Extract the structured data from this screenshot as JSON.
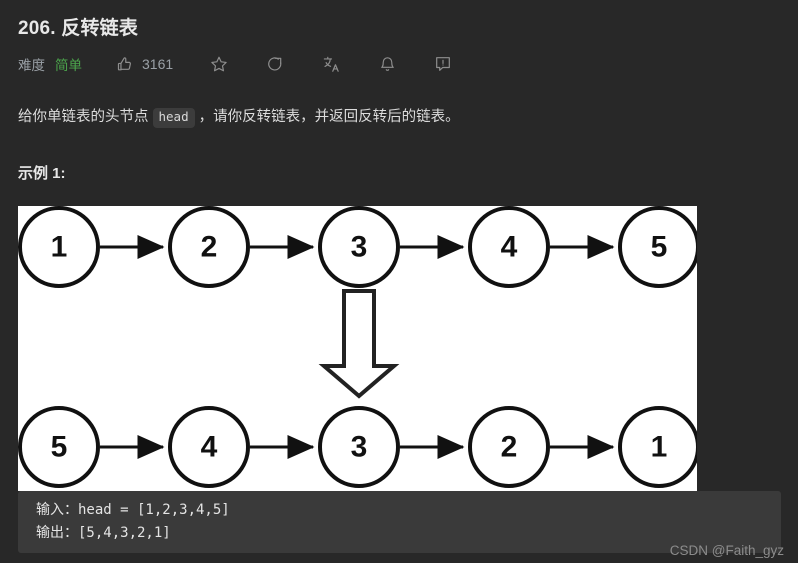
{
  "problem": {
    "title": "206. 反转链表",
    "difficulty_label": "难度",
    "difficulty_value": "简单",
    "likes_count": "3161",
    "description_part1": "给你单链表的头节点",
    "description_code": "head",
    "description_part2": "，请你反转链表，并返回反转后的链表。",
    "example_heading": "示例 1:"
  },
  "toolbar": {
    "thumbs_up_icon": "thumbs-up-icon",
    "star_icon": "star-icon",
    "share_icon": "share-icon",
    "translate_icon": "translate-icon",
    "bell_icon": "bell-icon",
    "feedback_icon": "feedback-icon"
  },
  "diagram": {
    "top_row": [
      "1",
      "2",
      "3",
      "4",
      "5"
    ],
    "bottom_row": [
      "5",
      "4",
      "3",
      "2",
      "1"
    ],
    "transform_arrow": "down-arrow-icon"
  },
  "code": {
    "input_line": "输入：head = [1,2,3,4,5]",
    "output_line": "输出：[5,4,3,2,1]"
  },
  "watermark": "CSDN @Faith_gyz",
  "colors": {
    "background": "#282828",
    "difficulty_green": "#4ca64c",
    "code_block_bg": "#3a3a3a",
    "inline_code_bg": "#3c3c3c",
    "muted_text": "#9aa0a6"
  }
}
